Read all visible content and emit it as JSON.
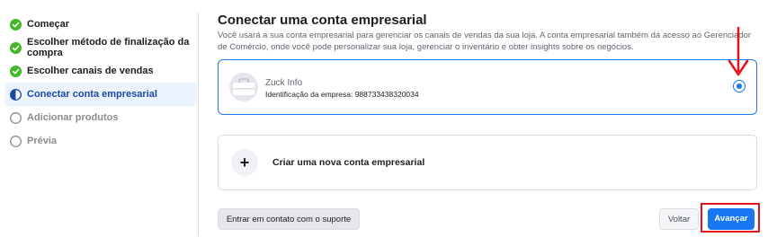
{
  "steps": [
    {
      "label": "Começar",
      "status": "done"
    },
    {
      "label": "Escolher método de finalização da compra",
      "status": "done"
    },
    {
      "label": "Escolher canais de vendas",
      "status": "done"
    },
    {
      "label": "Conectar conta empresarial",
      "status": "current"
    },
    {
      "label": "Adicionar produtos",
      "status": "pending"
    },
    {
      "label": "Prévia",
      "status": "pending"
    }
  ],
  "main": {
    "title": "Conectar uma conta empresarial",
    "description": "Você usará a sua conta empresarial para gerenciar os canais de vendas da sua loja. A conta empresarial também dá acesso ao Gerenciador de Comércio, onde você pode personalizar sua loja, gerenciar o inventário e obter insights sobre os negócios.",
    "business": {
      "name": "Zuck Info",
      "id_text": "Identificação da empresa: 988733438320034",
      "selected": true
    },
    "create_label": "Criar uma nova conta empresarial",
    "create_icon": "plus-icon"
  },
  "buttons": {
    "support": "Entrar em contato com o suporte",
    "back": "Voltar",
    "next": "Avançar"
  },
  "colors": {
    "accent": "#1877f2",
    "done": "#42b72a",
    "annotation": "#e4131b"
  }
}
